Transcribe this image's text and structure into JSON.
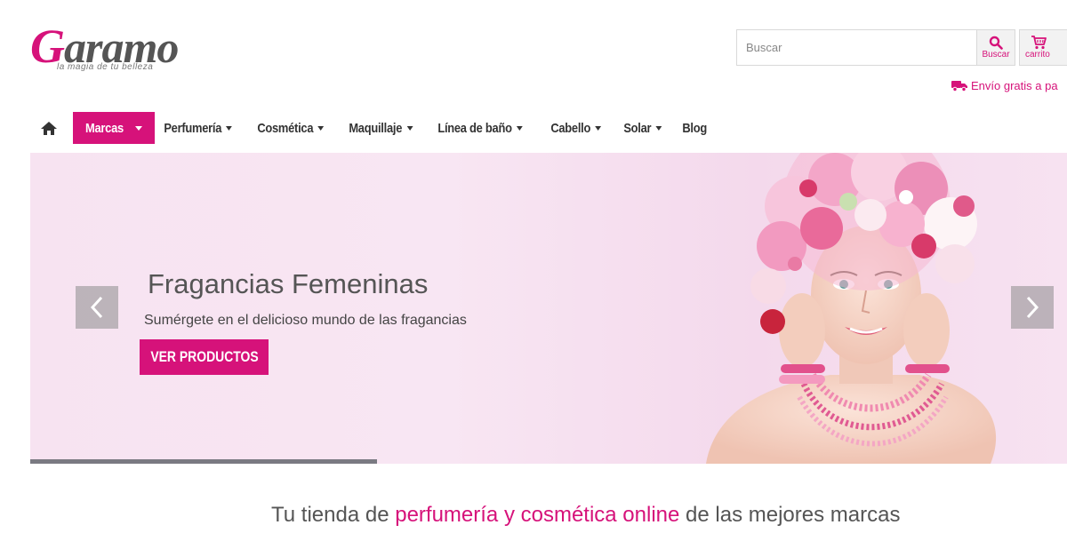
{
  "brand": {
    "logo_first_letter": "G",
    "logo_rest": "aramo",
    "tagline": "la magia de tu belleza",
    "accent_color": "#d6127a"
  },
  "header": {
    "search_placeholder": "Buscar",
    "search_button_label": "Buscar",
    "cart_button_label": "carrito",
    "shipping_text": "Envío gratis a pa"
  },
  "nav": {
    "items": [
      {
        "label": "Marcas",
        "active": true,
        "dropdown": true
      },
      {
        "label": "Perfumería",
        "dropdown": true
      },
      {
        "label": "Cosmética",
        "dropdown": true
      },
      {
        "label": "Maquillaje",
        "dropdown": true
      },
      {
        "label": "Línea de baño",
        "dropdown": true
      },
      {
        "label": "Cabello",
        "dropdown": true
      },
      {
        "label": "Solar",
        "dropdown": true
      },
      {
        "label": "Blog",
        "dropdown": false
      }
    ]
  },
  "hero": {
    "title": "Fragancias Femeninas",
    "subtitle": "Sumérgete en el delicioso mundo de las fragancias",
    "cta_label": "VER PRODUCTOS"
  },
  "intro": {
    "text_before": "Tu tienda de ",
    "highlight": "perfumería y cosmética online",
    "text_after": " de las mejores marcas"
  }
}
